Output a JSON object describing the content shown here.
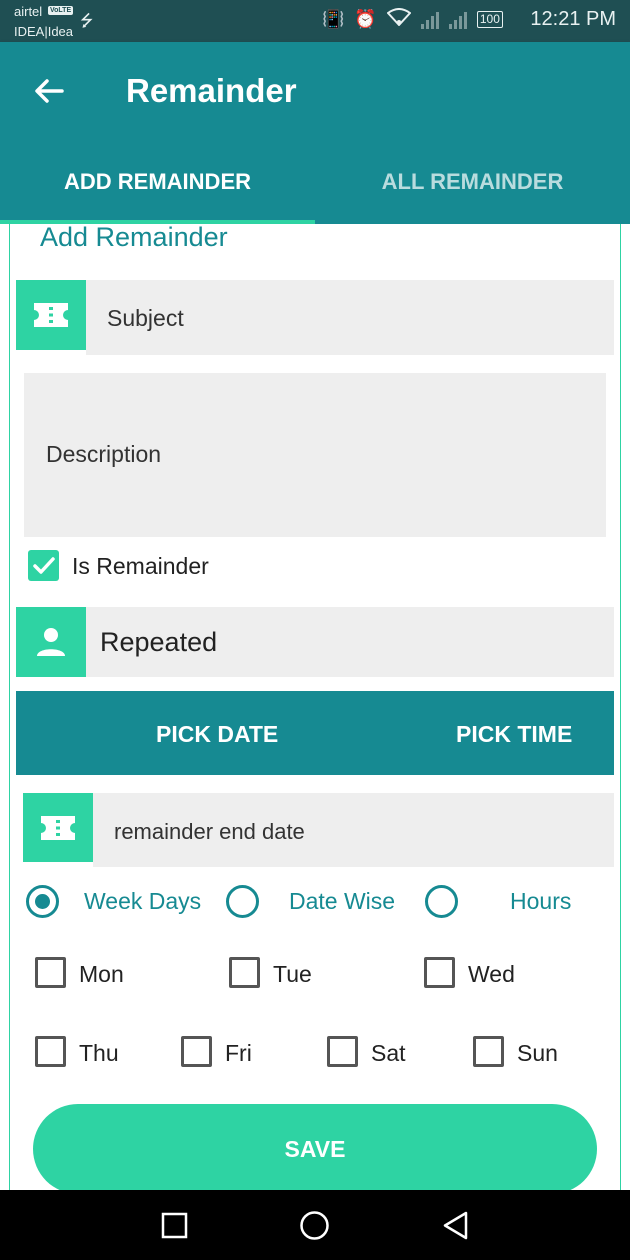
{
  "status_bar": {
    "carrier1": "airtel",
    "volte": "VoLTE",
    "carrier2": "IDEA|Idea",
    "battery": "100",
    "time": "12:21 PM"
  },
  "appbar": {
    "title": "Remainder",
    "back_icon": "arrow-back-icon"
  },
  "tabs": [
    {
      "label": "ADD REMAINDER",
      "active": true
    },
    {
      "label": "ALL REMAINDER",
      "active": false
    }
  ],
  "form": {
    "section_title": "Add Remainder",
    "subject_placeholder": "Subject",
    "description_placeholder": "Description",
    "is_remainder_label": "Is Remainder",
    "is_remainder_checked": true,
    "repeated_value": "Repeated",
    "pick_date_label": "PICK DATE",
    "pick_time_label": "PICK TIME",
    "end_date_placeholder": "remainder end date",
    "radio_options": [
      {
        "label": "Week Days",
        "selected": true
      },
      {
        "label": "Date Wise",
        "selected": false
      },
      {
        "label": "Hours",
        "selected": false
      }
    ],
    "days_row1": [
      "Mon",
      "Tue",
      "Wed"
    ],
    "days_row2": [
      "Thu",
      "Fri",
      "Sat",
      "Sun"
    ],
    "save_label": "SAVE"
  },
  "colors": {
    "primary": "#168a92",
    "accent": "#2ed3a3",
    "status": "#1f4f53"
  }
}
